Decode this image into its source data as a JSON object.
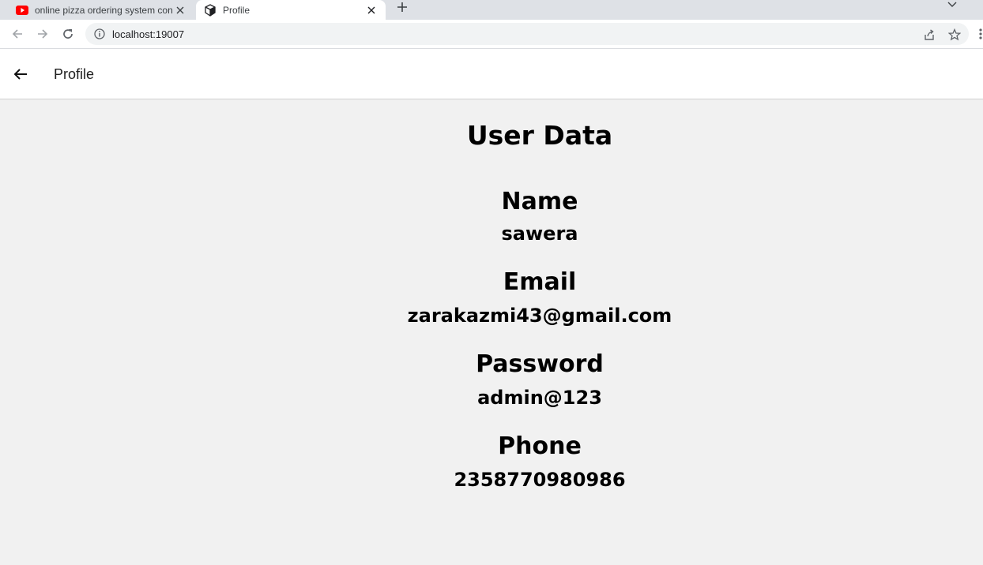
{
  "browser": {
    "tabs": [
      {
        "title": "online pizza ordering system con",
        "favicon": "youtube-icon",
        "active": false
      },
      {
        "title": "Profile",
        "favicon": "cube-icon",
        "active": true
      }
    ],
    "url": "localhost:19007"
  },
  "header": {
    "title": "Profile"
  },
  "page": {
    "title": "User Data",
    "fields": [
      {
        "label": "Name",
        "value": "sawera"
      },
      {
        "label": "Email",
        "value": "zarakazmi43@gmail.com"
      },
      {
        "label": "Password",
        "value": "admin@123"
      },
      {
        "label": "Phone",
        "value": "2358770980986"
      }
    ]
  },
  "colors": {
    "page_background": "#f1f1f1",
    "header_background": "#ffffff",
    "youtube_red": "#ff0000"
  }
}
